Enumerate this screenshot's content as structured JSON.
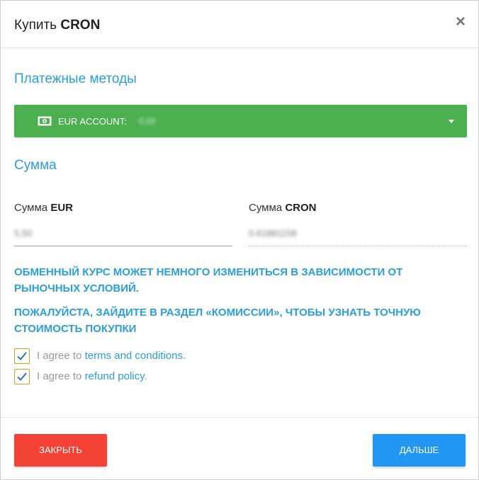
{
  "header": {
    "title_prefix": "Купить",
    "title_token": "CRON",
    "close_glyph": "×"
  },
  "payment": {
    "section_title": "Платежные методы",
    "account_label": "EUR ACCOUNT:",
    "account_value_blurred": "0,33",
    "icon": "money-icon",
    "color": "#4caf50"
  },
  "amount": {
    "section_title": "Сумма",
    "eur_label_prefix": "Сумма",
    "eur_label_currency": "EUR",
    "eur_value_blurred": "5,50",
    "cron_label_prefix": "Сумма",
    "cron_label_currency": "CRON",
    "cron_value_blurred": "0.61881158"
  },
  "notices": {
    "rate_notice": "ОБМЕННЫЙ КУРС МОЖЕТ НЕМНОГО ИЗМЕНИТЬСЯ В ЗАВИСИМОСТИ ОТ РЫНОЧНЫХ УСЛОВИЙ.",
    "fee_notice": "ПОЖАЛУЙСТА, ЗАЙДИТЕ В РАЗДЕЛ «КОМИССИИ», ЧТОБЫ УЗНАТЬ ТОЧНУЮ СТОИМОСТЬ ПОКУПКИ"
  },
  "agreements": [
    {
      "prefix": "I agree to",
      "link": "terms and conditions",
      "suffix": ".",
      "checked": true
    },
    {
      "prefix": "I agree to",
      "link": "refund policy",
      "suffix": ".",
      "checked": true
    }
  ],
  "buttons": {
    "close_label": "ЗАКРЫТЬ",
    "close_color": "#f44336",
    "next_label": "ДАЛЬШЕ",
    "next_color": "#2196f3"
  },
  "colors": {
    "accent": "#2a9fd8"
  }
}
